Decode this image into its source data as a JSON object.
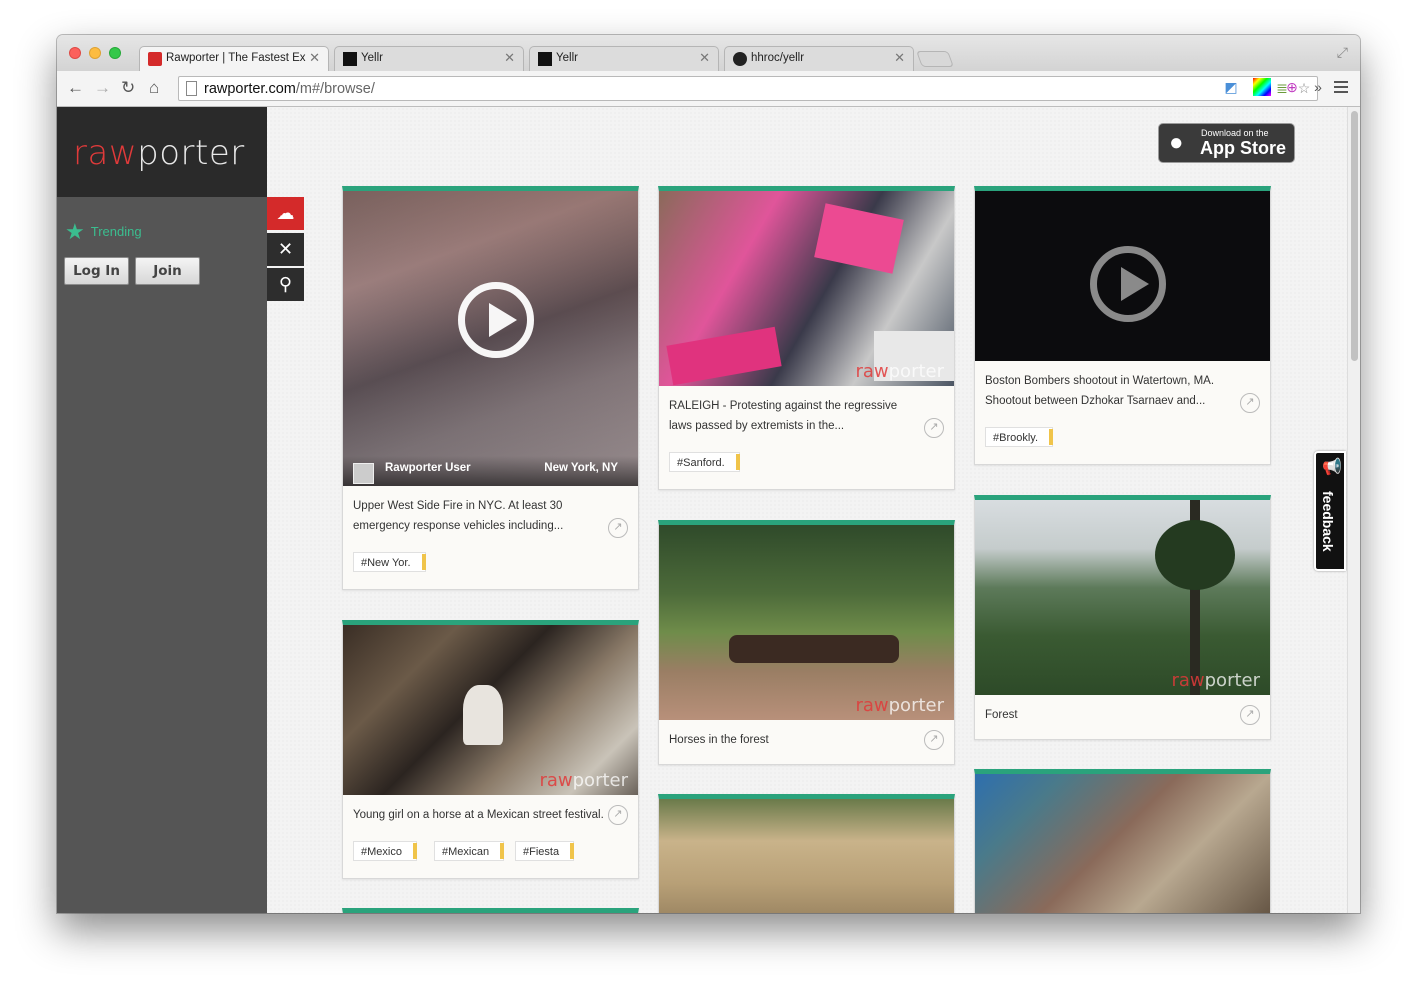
{
  "browser": {
    "tabs": [
      {
        "label": "Rawporter | The Fastest Ex",
        "active": true
      },
      {
        "label": "Yellr",
        "active": false
      },
      {
        "label": "Yellr",
        "active": false
      },
      {
        "label": "hhroc/yellr",
        "active": false
      }
    ],
    "url_host": "rawporter.com",
    "url_path": "/m#/browse/"
  },
  "sidebar": {
    "logo_r": "raw",
    "logo_p": "porter",
    "trending": "Trending",
    "login": "Log In",
    "join": "Join"
  },
  "appstore": {
    "small": "Download on the",
    "big": "App Store"
  },
  "feedback": "feedback",
  "cards": [
    {
      "caption": "Upper West Side Fire in NYC. At least 30 emergency response vehicles including...",
      "user": "Rawporter User",
      "location": "New York, NY",
      "tags": [
        "#New Yor."
      ]
    },
    {
      "caption": "RALEIGH - Protesting against the regressive laws passed by extremists in the...",
      "tags": [
        "#Sanford."
      ]
    },
    {
      "caption": "Boston Bombers shootout in Watertown, MA. Shootout between Dzhokar Tsarnaev and...",
      "tags": [
        "#Brookly."
      ]
    },
    {
      "caption": "Young girl on a horse at a Mexican street festival.",
      "tags": [
        "#Mexico",
        "#Mexican",
        "#Fiesta"
      ]
    },
    {
      "caption": "Horses in the forest",
      "tags": []
    },
    {
      "caption": "Forest",
      "tags": []
    }
  ],
  "watermark": {
    "r": "raw",
    "p": "porter"
  },
  "colors": {
    "accent": "#2aa37c",
    "brand_red": "#d42a2a",
    "sidebar": "#555555",
    "tag_flag": "#f0c44a"
  }
}
